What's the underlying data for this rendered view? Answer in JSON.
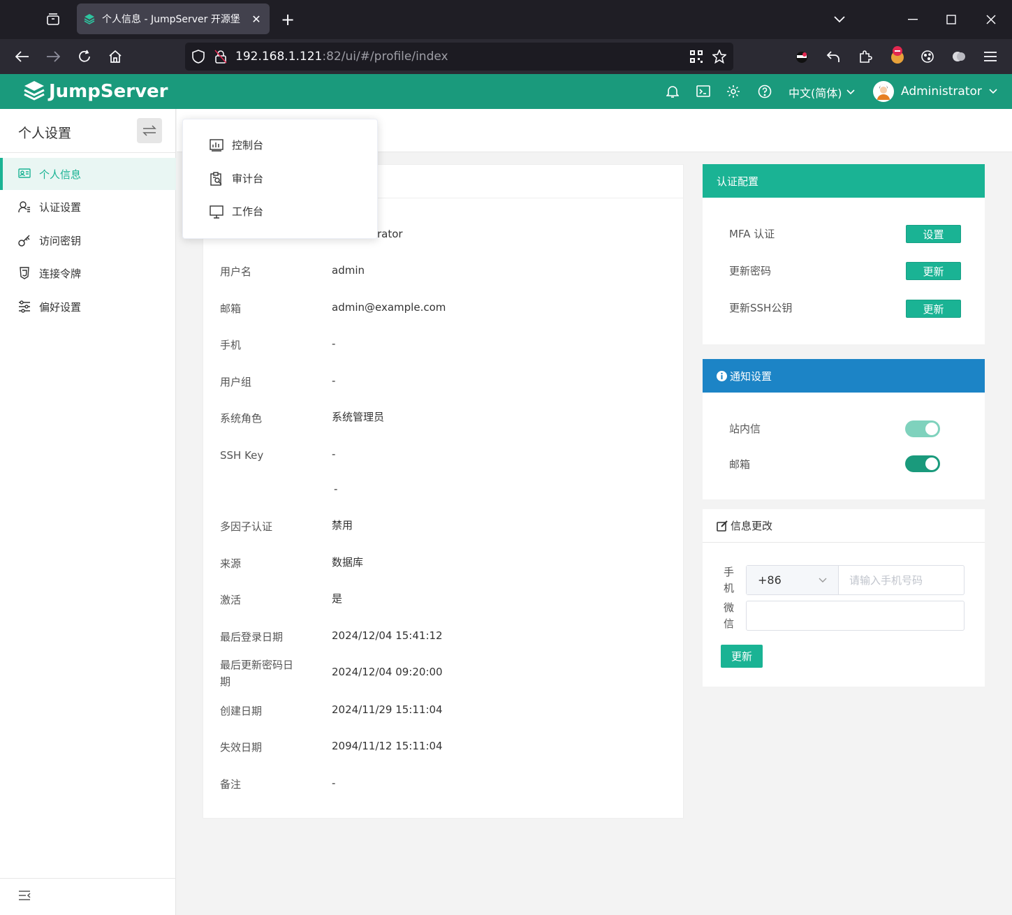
{
  "browser": {
    "tab_title": "个人信息 - JumpServer 开源堡",
    "new_tab": "+",
    "url_host": "192.168.1.121",
    "url_path": ":82/ui/#/profile/index"
  },
  "header": {
    "brand": "JumpServer",
    "language": "中文(简体)",
    "username": "Administrator",
    "accent_color": "#1a9a7c"
  },
  "sidebar": {
    "title": "个人设置",
    "items": [
      {
        "label": "个人信息",
        "icon": "id-card-icon",
        "active": true
      },
      {
        "label": "认证设置",
        "icon": "user-settings-icon",
        "active": false
      },
      {
        "label": "访问密钥",
        "icon": "key-icon",
        "active": false
      },
      {
        "label": "连接令牌",
        "icon": "token-icon",
        "active": false
      },
      {
        "label": "偏好设置",
        "icon": "sliders-icon",
        "active": false
      }
    ]
  },
  "dropdown": {
    "items": [
      {
        "label": "控制台",
        "icon": "dashboard-icon"
      },
      {
        "label": "审计台",
        "icon": "audit-icon"
      },
      {
        "label": "工作台",
        "icon": "monitor-icon"
      }
    ]
  },
  "profile": {
    "name_partial": "rator",
    "rows": [
      {
        "label": "用户名",
        "value": "admin"
      },
      {
        "label": "邮箱",
        "value": "admin@example.com"
      },
      {
        "label": "手机",
        "value": "-"
      },
      {
        "label": "用户组",
        "value": "-"
      },
      {
        "label": "系统角色",
        "value": "系统管理员"
      },
      {
        "label": "SSH Key",
        "value": "-"
      },
      {
        "label": "",
        "value": "-"
      },
      {
        "label": "多因子认证",
        "value": "禁用"
      },
      {
        "label": "来源",
        "value": "数据库"
      },
      {
        "label": "激活",
        "value": "是"
      },
      {
        "label": "最后登录日期",
        "value": "2024/12/04 15:41:12"
      },
      {
        "label": "最后更新密码日期",
        "value": "2024/12/04 09:20:00"
      },
      {
        "label": "创建日期",
        "value": "2024/11/29 15:11:04"
      },
      {
        "label": "失效日期",
        "value": "2094/11/12 15:11:04"
      },
      {
        "label": "备注",
        "value": "-"
      }
    ]
  },
  "auth_config": {
    "title": "认证配置",
    "rows": [
      {
        "label": "MFA 认证",
        "button": "设置"
      },
      {
        "label": "更新密码",
        "button": "更新"
      },
      {
        "label": "更新SSH公钥",
        "button": "更新"
      }
    ]
  },
  "notify": {
    "title": "通知设置",
    "rows": [
      {
        "label": "站内信",
        "enabled": true,
        "disabled_style": true
      },
      {
        "label": "邮箱",
        "enabled": true,
        "disabled_style": false
      }
    ]
  },
  "info_change": {
    "title": "信息更改",
    "phone_label": "手机",
    "wechat_label": "微信",
    "country_code": "+86",
    "phone_placeholder": "请输入手机号码",
    "submit": "更新"
  }
}
